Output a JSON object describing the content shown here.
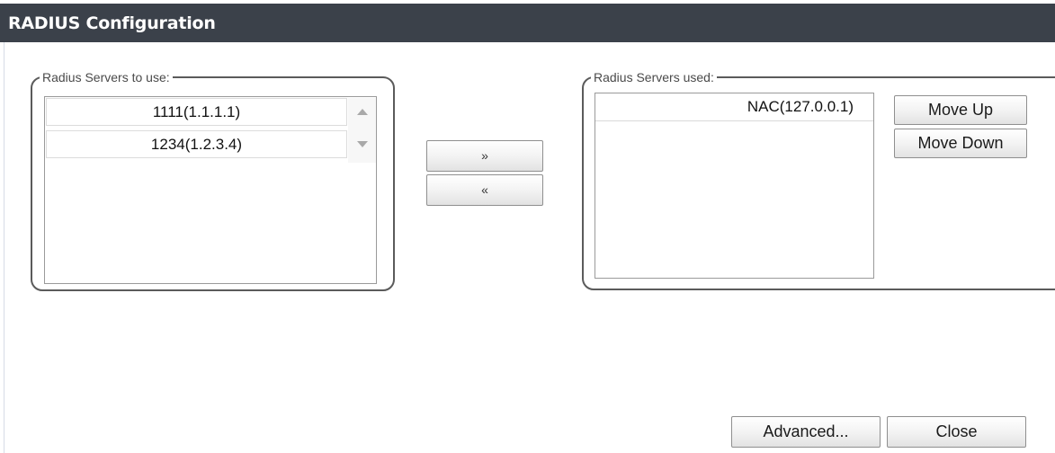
{
  "dialog": {
    "title": "RADIUS Configuration"
  },
  "available": {
    "legend": "Radius Servers to use:",
    "items": [
      "1111(1.1.1.1)",
      "1234(1.2.3.4)"
    ]
  },
  "used": {
    "legend": "Radius Servers used:",
    "items": [
      "NAC(127.0.0.1)"
    ]
  },
  "transfer": {
    "add_label": "»",
    "remove_label": "«"
  },
  "ordering": {
    "move_up_label": "Move Up",
    "move_down_label": "Move Down"
  },
  "footer": {
    "advanced_label": "Advanced...",
    "close_label": "Close"
  },
  "colors": {
    "titlebar": "#3b414a",
    "title_text": "#ffffff",
    "group_border": "#5b5b5b"
  },
  "icons": {
    "scroll_up": "triangle-up",
    "scroll_down": "triangle-down"
  }
}
